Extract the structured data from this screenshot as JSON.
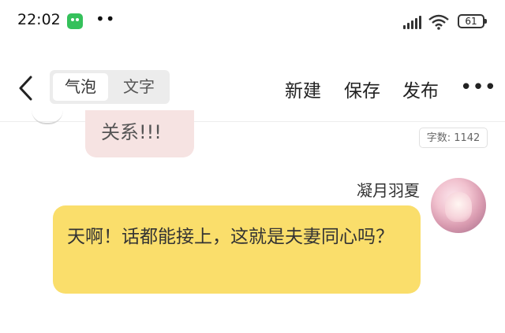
{
  "status_bar": {
    "time": "22:02",
    "app_icon": "wechat-like-icon",
    "more_indicator": "••",
    "battery": "61",
    "icons": [
      "signal-icon",
      "wifi-icon",
      "battery-icon"
    ]
  },
  "nav": {
    "back_icon": "chevron-left-icon",
    "segment": {
      "bubble": "气泡",
      "text": "文字",
      "selected": "bubble"
    },
    "actions": {
      "new": "新建",
      "save": "保存",
      "publish": "发布"
    },
    "more": "•••"
  },
  "chat": {
    "previous_bubble_text": "关系!!!",
    "word_count": {
      "label": "字数: ",
      "value": "1142"
    },
    "message": {
      "username": "凝月羽夏",
      "text": "天啊！话都能接上，这就是夫妻同心吗？"
    }
  },
  "colors": {
    "bubble_mine": "#fade6b",
    "bubble_other": "#f6e3e2",
    "segment_bg": "#ececec"
  }
}
